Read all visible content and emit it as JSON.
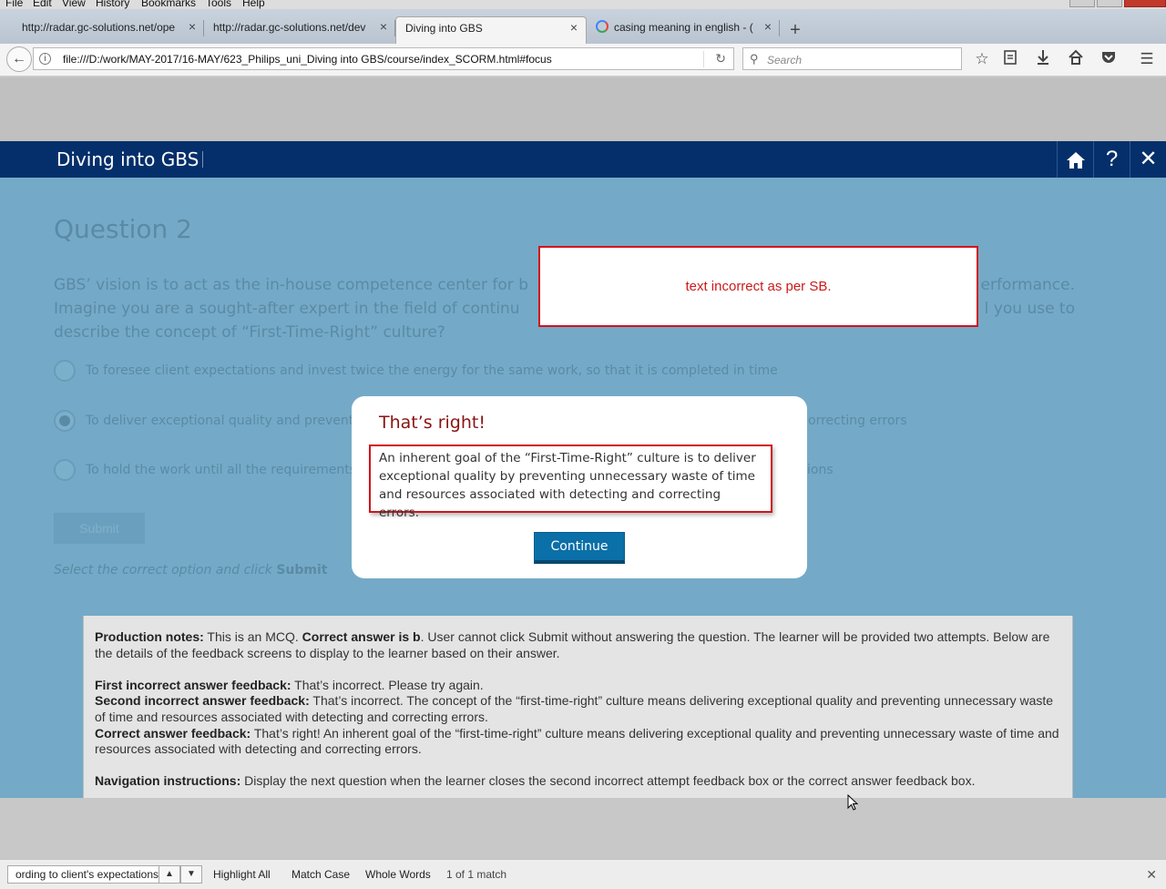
{
  "menubar": {
    "items": [
      "File",
      "Edit",
      "View",
      "History",
      "Bookmarks",
      "Tools",
      "Help"
    ]
  },
  "tabs": [
    {
      "label": "http://radar.gc-solutions.net/ope",
      "active": false
    },
    {
      "label": "http://radar.gc-solutions.net/dev",
      "active": false
    },
    {
      "label": "Diving into GBS",
      "active": true
    },
    {
      "label": "casing meaning in english - (",
      "active": false
    }
  ],
  "navbar": {
    "url": "file:///D:/work/MAY-2017/16-MAY/623_Philips_uni_Diving into GBS/course/index_SCORM.html#focus",
    "search_placeholder": "Search"
  },
  "course": {
    "title": "Diving into GBS",
    "question_title": "Question 2",
    "question_text_start": "GBS’ vision is to act as the in-house competence center for b",
    "question_text_end": "erformance.",
    "question_line2_start": "Imagine you are a sought-after expert in the field of continu",
    "question_line2_end": "l you use to",
    "question_line3": "describe the concept of “First-Time-Right” culture?",
    "options": [
      {
        "left": "To foresee client expectations and invest twice the energy for the same work, so that it is completed in time",
        "right": "",
        "selected": false
      },
      {
        "left": "To deliver exceptional quality and prevent",
        "right": "orrecting errors",
        "selected": true
      },
      {
        "left": "To hold the work until all the requirements",
        "right": "ions",
        "selected": false
      }
    ],
    "submit_label": "Submit",
    "instruction_prefix": "Select the correct option and click ",
    "instruction_bold": "Submit"
  },
  "review_comment": "text incorrect as per SB.",
  "modal": {
    "title": "That’s right!",
    "text": "An inherent goal of the “First-Time-Right” culture is to deliver exceptional quality by preventing unnecessary waste of time and resources associated with detecting and correcting errors.",
    "continue_label": "Continue"
  },
  "production_notes": {
    "p1_label": "Production notes:",
    "p1_text_a": " This is an MCQ. ",
    "p1_bold2": "Correct answer is b",
    "p1_text_b": ". User cannot click Submit without answering the question. The learner will be provided two attempts. Below are the details of the feedback screens to display to the learner based on their answer.",
    "first_label": "First incorrect answer feedback:",
    "first_text": " That’s incorrect. Please try again.",
    "second_label": "Second incorrect answer feedback:",
    "second_text": " That’s incorrect. The concept of the “first-time-right” culture means delivering exceptional quality and preventing unnecessary waste of time and resources associated with detecting and correcting errors.",
    "correct_label": "Correct answer feedback:",
    "correct_text": " That’s right! An inherent goal of the “first-time-right” culture means delivering exceptional quality and preventing unnecessary waste of time and resources associated with detecting and correcting errors.",
    "nav_label": "Navigation instructions:",
    "nav_text": " Display the next question when the learner closes the second incorrect attempt feedback box or the correct answer feedback box."
  },
  "findbar": {
    "query": "ording to client's expectations",
    "highlight_all": "Highlight All",
    "match_case": "Match Case",
    "whole_words": "Whole Words",
    "count": "1 of 1 match"
  }
}
